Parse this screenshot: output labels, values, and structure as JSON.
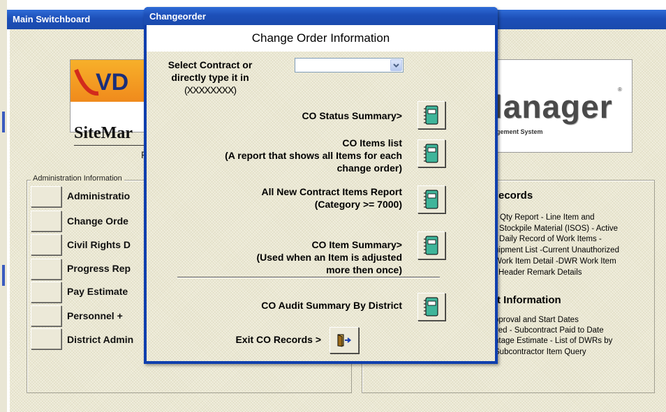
{
  "background_window": {
    "title": "Main Switchboard",
    "logo_left_text": "VD",
    "brand_text": "SiteMar",
    "brand_sub_fragment": "F",
    "logo_right_text": "lanager",
    "logo_right_sub": "gement System",
    "admin_group_title": "Administration Information",
    "admin_buttons": [
      "Administratio",
      "Change Orde",
      "Civil Rights D",
      "Progress Rep",
      "Pay Estimate",
      "Personnel +",
      "District Admin"
    ],
    "records_heading": "ecords",
    "records_lines": [
      "Qty Report - Line Item and",
      "- Stockpile Material (ISOS) - Active",
      "- Daily Record of Work Items -",
      "uipment List -Current Unauthorized",
      "Work Item Detail -DWR Work Item",
      "Header Remark Details"
    ],
    "contract_heading": "t Information",
    "contract_lines": [
      "pproval and Start Dates",
      "ved  - Subcontract Paid to Date",
      "ntage Estimate  - List of DWRs by",
      "Subcontractor Item Query"
    ]
  },
  "dialog": {
    "title": "Changeorder",
    "header": "Change Order Information",
    "select_label_line1": "Select Contract or",
    "select_label_line2": "directly type it in",
    "select_label_line3": "(XXXXXXXX)",
    "select_value": "",
    "reports": [
      {
        "lines": [
          "CO Status Summary>"
        ]
      },
      {
        "lines": [
          "CO Items list",
          "(A report that shows all Items for each",
          "change order)"
        ]
      },
      {
        "lines": [
          "All New Contract Items Report",
          "(Category >= 7000)"
        ]
      },
      {
        "lines": [
          "CO Item Summary>",
          "(Used when an Item is adjusted",
          "more then once)"
        ]
      },
      {
        "lines": [
          "CO Audit Summary By District"
        ]
      }
    ],
    "exit_label": "Exit CO Records >"
  },
  "colors": {
    "titlebar": "#1d4fb8",
    "form_bg": "#ebe8d2",
    "report_icon": "#3fb59a"
  }
}
